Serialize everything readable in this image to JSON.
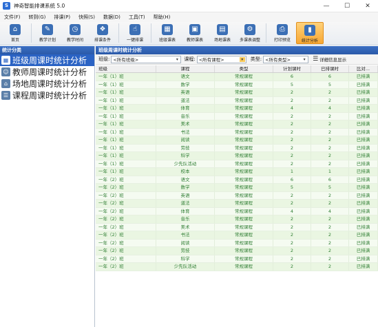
{
  "window": {
    "title": "神奇智能排课系统 5.0",
    "min": "—",
    "max": "☐",
    "close": "✕",
    "app_icon": "S"
  },
  "menu": [
    "文件(F)",
    "转到(G)",
    "排课(P)",
    "快照(S)",
    "数据(D)",
    "工具(T)",
    "帮助(H)"
  ],
  "toolbar": [
    {
      "label": "首页",
      "icon": "⌂",
      "name": "home"
    },
    {
      "label": "教学计划",
      "icon": "✎",
      "name": "teaching-plan"
    },
    {
      "label": "教学时间",
      "icon": "◷",
      "name": "teaching-time"
    },
    {
      "label": "排课条件",
      "icon": "❖",
      "name": "schedule-conditions"
    },
    {
      "label": "一键排课",
      "icon": "☝",
      "name": "one-click-schedule"
    },
    {
      "label": "班级课表",
      "icon": "▦",
      "name": "class-timetable"
    },
    {
      "label": "教师课表",
      "icon": "▣",
      "name": "teacher-timetable"
    },
    {
      "label": "场地课表",
      "icon": "▤",
      "name": "venue-timetable"
    },
    {
      "label": "多课表调整",
      "icon": "⚙",
      "name": "multi-timetable-adjust"
    },
    {
      "label": "打印预览",
      "icon": "⎙",
      "name": "print-preview"
    },
    {
      "label": "统计分析",
      "icon": "▮",
      "name": "statistics",
      "active": true
    }
  ],
  "left_panel": {
    "header": "统计分类",
    "items": [
      {
        "label": "班级周课时统计分析",
        "icon": "▦",
        "active": true
      },
      {
        "label": "教师周课时统计分析",
        "icon": "☺",
        "active": false
      },
      {
        "label": "场地周课时统计分析",
        "icon": "⌂",
        "active": false
      },
      {
        "label": "课程周课时统计分析",
        "icon": "☰",
        "active": false
      }
    ]
  },
  "right_panel": {
    "header": "班级周课时统计分析",
    "filters": {
      "class_label": "班级:",
      "class_value": "<所有班级>",
      "course_label": "课程:",
      "course_value": "<所有课程>",
      "type_label": "类型:",
      "type_value": "<所有类型>",
      "detail_label": "详细信息显示"
    },
    "columns": [
      "班级",
      "课程",
      "类型",
      "计划课时",
      "已排课时",
      "比对..."
    ],
    "rows": [
      [
        "一年（1）班",
        "语文",
        "常规课程",
        "6",
        "6",
        "已排满"
      ],
      [
        "一年（1）班",
        "数学",
        "常规课程",
        "5",
        "5",
        "已排满"
      ],
      [
        "一年（1）班",
        "英语",
        "常规课程",
        "2",
        "2",
        "已排满"
      ],
      [
        "一年（1）班",
        "道法",
        "常规课程",
        "2",
        "2",
        "已排满"
      ],
      [
        "一年（1）班",
        "体育",
        "常规课程",
        "4",
        "4",
        "已排满"
      ],
      [
        "一年（1）班",
        "音乐",
        "常规课程",
        "2",
        "2",
        "已排满"
      ],
      [
        "一年（1）班",
        "美术",
        "常规课程",
        "2",
        "2",
        "已排满"
      ],
      [
        "一年（1）班",
        "书法",
        "常规课程",
        "2",
        "2",
        "已排满"
      ],
      [
        "一年（1）班",
        "阅读",
        "常规课程",
        "2",
        "2",
        "已排满"
      ],
      [
        "一年（1）班",
        "劳技",
        "常规课程",
        "2",
        "2",
        "已排满"
      ],
      [
        "一年（1）班",
        "科学",
        "常规课程",
        "2",
        "2",
        "已排满"
      ],
      [
        "一年（1）班",
        "少先队活动",
        "常规课程",
        "2",
        "2",
        "已排满"
      ],
      [
        "一年（1）班",
        "校本",
        "常规课程",
        "1",
        "1",
        "已排满"
      ],
      [
        "一年（2）班",
        "语文",
        "常规课程",
        "6",
        "6",
        "已排满"
      ],
      [
        "一年（2）班",
        "数学",
        "常规课程",
        "5",
        "5",
        "已排满"
      ],
      [
        "一年（2）班",
        "英语",
        "常规课程",
        "2",
        "2",
        "已排满"
      ],
      [
        "一年（2）班",
        "道法",
        "常规课程",
        "2",
        "2",
        "已排满"
      ],
      [
        "一年（2）班",
        "体育",
        "常规课程",
        "4",
        "4",
        "已排满"
      ],
      [
        "一年（2）班",
        "音乐",
        "常规课程",
        "2",
        "2",
        "已排满"
      ],
      [
        "一年（2）班",
        "美术",
        "常规课程",
        "2",
        "2",
        "已排满"
      ],
      [
        "一年（2）班",
        "书法",
        "常规课程",
        "2",
        "2",
        "已排满"
      ],
      [
        "一年（2）班",
        "阅读",
        "常规课程",
        "2",
        "2",
        "已排满"
      ],
      [
        "一年（2）班",
        "劳技",
        "常规课程",
        "2",
        "2",
        "已排满"
      ],
      [
        "一年（2）班",
        "科学",
        "常规课程",
        "2",
        "2",
        "已排满"
      ],
      [
        "一年（2）班",
        "少先队活动",
        "常规课程",
        "2",
        "2",
        "已排满"
      ]
    ]
  }
}
